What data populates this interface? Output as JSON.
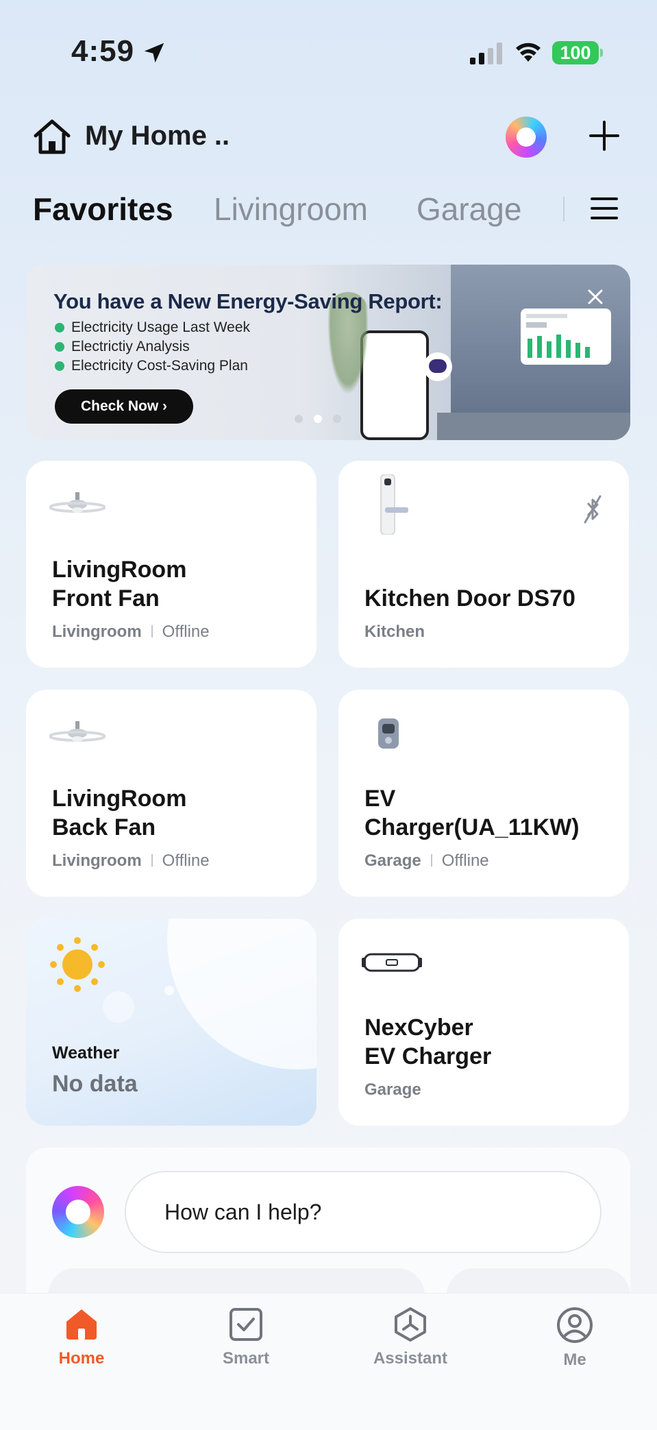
{
  "status_bar": {
    "time": "4:59",
    "battery": "100"
  },
  "header": {
    "home_title": "My Home .."
  },
  "tabs": [
    {
      "label": "Favorites"
    },
    {
      "label": "Livingroom"
    },
    {
      "label": "Garage"
    }
  ],
  "banner": {
    "title": "You have a New Energy-Saving Report:",
    "items": [
      "Electricity Usage Last Week",
      "Electrictiy Analysis",
      "Electricity Cost-Saving Plan"
    ],
    "button": "Check Now",
    "active_dot": 1
  },
  "devices": [
    {
      "name_line1": "LivingRoom",
      "name_line2": "Front Fan",
      "room": "Livingroom",
      "status": "Offline",
      "icon": "ceiling-fan-icon"
    },
    {
      "name_line1": "Kitchen Door DS70",
      "name_line2": "",
      "room": "Kitchen",
      "status": "",
      "icon": "door-lock-icon"
    },
    {
      "name_line1": "LivingRoom",
      "name_line2": "Back Fan",
      "room": "Livingroom",
      "status": "Offline",
      "icon": "ceiling-fan-icon"
    },
    {
      "name_line1": "EV",
      "name_line2": "Charger(UA_11KW)",
      "room": "Garage",
      "status": "Offline",
      "icon": "ev-charger-icon"
    },
    {
      "name_line1": "NexCyber",
      "name_line2": "EV Charger",
      "room": "Garage",
      "status": "",
      "icon": "portable-charger-icon"
    }
  ],
  "weather": {
    "label": "Weather",
    "value": "No data"
  },
  "assistant": {
    "placeholder": "How can I help?"
  },
  "bottom_nav": [
    {
      "label": "Home",
      "active": true
    },
    {
      "label": "Smart",
      "active": false
    },
    {
      "label": "Assistant",
      "active": false
    },
    {
      "label": "Me",
      "active": false
    }
  ],
  "colors": {
    "accent": "#f05a28",
    "online_dot": "#2bb673",
    "battery": "#34c759"
  }
}
